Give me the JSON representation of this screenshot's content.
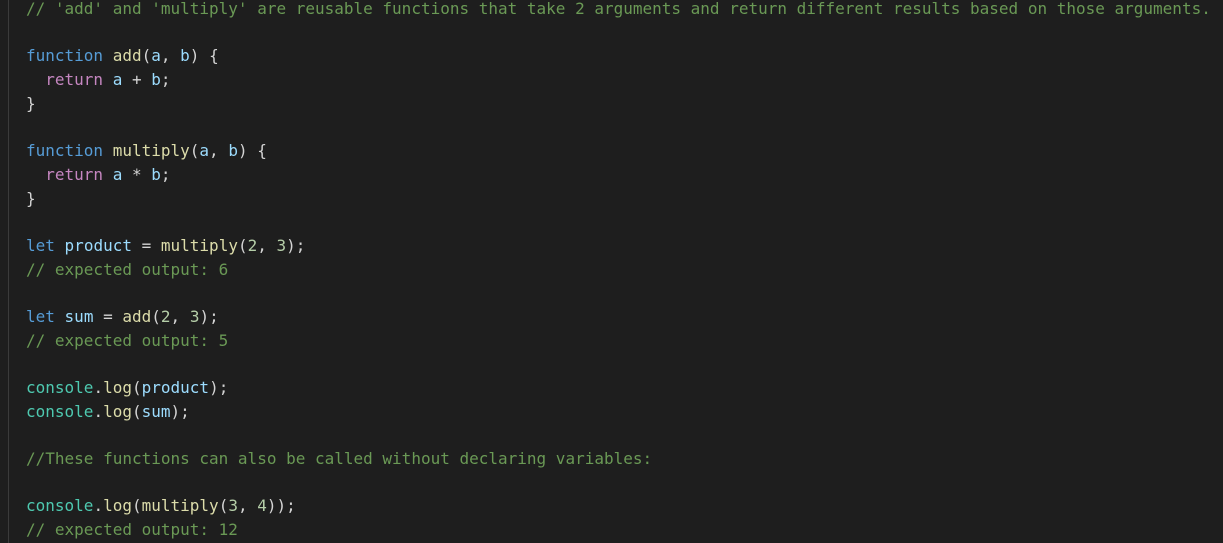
{
  "editor": {
    "theme": {
      "background": "#1e1e1e",
      "keyword": "#569cd6",
      "control": "#c586c0",
      "function": "#dcdcaa",
      "variable": "#9cdcfe",
      "object": "#4ec9b0",
      "number": "#b5cea8",
      "comment": "#6a9955",
      "text": "#d4d4d4"
    },
    "lines": [
      [
        {
          "t": "// 'add' and 'multiply' are reusable functions that take 2 arguments and return different results based on those arguments.",
          "c": "cm"
        }
      ],
      [],
      [
        {
          "t": "function",
          "c": "kw-blue"
        },
        {
          "t": " ",
          "c": "pl"
        },
        {
          "t": "add",
          "c": "fn"
        },
        {
          "t": "(",
          "c": "pl"
        },
        {
          "t": "a",
          "c": "var"
        },
        {
          "t": ", ",
          "c": "pl"
        },
        {
          "t": "b",
          "c": "var"
        },
        {
          "t": ") {",
          "c": "pl"
        }
      ],
      [
        {
          "t": "  ",
          "c": "pl"
        },
        {
          "t": "return",
          "c": "kw-ctrl"
        },
        {
          "t": " ",
          "c": "pl"
        },
        {
          "t": "a",
          "c": "var"
        },
        {
          "t": " + ",
          "c": "pl"
        },
        {
          "t": "b",
          "c": "var"
        },
        {
          "t": ";",
          "c": "pl"
        }
      ],
      [
        {
          "t": "}",
          "c": "pl"
        }
      ],
      [],
      [
        {
          "t": "function",
          "c": "kw-blue"
        },
        {
          "t": " ",
          "c": "pl"
        },
        {
          "t": "multiply",
          "c": "fn"
        },
        {
          "t": "(",
          "c": "pl"
        },
        {
          "t": "a",
          "c": "var"
        },
        {
          "t": ", ",
          "c": "pl"
        },
        {
          "t": "b",
          "c": "var"
        },
        {
          "t": ") {",
          "c": "pl"
        }
      ],
      [
        {
          "t": "  ",
          "c": "pl"
        },
        {
          "t": "return",
          "c": "kw-ctrl"
        },
        {
          "t": " ",
          "c": "pl"
        },
        {
          "t": "a",
          "c": "var"
        },
        {
          "t": " * ",
          "c": "pl"
        },
        {
          "t": "b",
          "c": "var"
        },
        {
          "t": ";",
          "c": "pl"
        }
      ],
      [
        {
          "t": "}",
          "c": "pl"
        }
      ],
      [],
      [
        {
          "t": "let",
          "c": "kw-blue"
        },
        {
          "t": " ",
          "c": "pl"
        },
        {
          "t": "product",
          "c": "var"
        },
        {
          "t": " = ",
          "c": "pl"
        },
        {
          "t": "multiply",
          "c": "fn"
        },
        {
          "t": "(",
          "c": "pl"
        },
        {
          "t": "2",
          "c": "num"
        },
        {
          "t": ", ",
          "c": "pl"
        },
        {
          "t": "3",
          "c": "num"
        },
        {
          "t": ");",
          "c": "pl"
        }
      ],
      [
        {
          "t": "// expected output: 6",
          "c": "cm"
        }
      ],
      [],
      [
        {
          "t": "let",
          "c": "kw-blue"
        },
        {
          "t": " ",
          "c": "pl"
        },
        {
          "t": "sum",
          "c": "var"
        },
        {
          "t": " = ",
          "c": "pl"
        },
        {
          "t": "add",
          "c": "fn"
        },
        {
          "t": "(",
          "c": "pl"
        },
        {
          "t": "2",
          "c": "num"
        },
        {
          "t": ", ",
          "c": "pl"
        },
        {
          "t": "3",
          "c": "num"
        },
        {
          "t": ");",
          "c": "pl"
        }
      ],
      [
        {
          "t": "// expected output: 5",
          "c": "cm"
        }
      ],
      [],
      [
        {
          "t": "console",
          "c": "obj"
        },
        {
          "t": ".",
          "c": "pl"
        },
        {
          "t": "log",
          "c": "fn"
        },
        {
          "t": "(",
          "c": "pl"
        },
        {
          "t": "product",
          "c": "var"
        },
        {
          "t": ");",
          "c": "pl"
        }
      ],
      [
        {
          "t": "console",
          "c": "obj"
        },
        {
          "t": ".",
          "c": "pl"
        },
        {
          "t": "log",
          "c": "fn"
        },
        {
          "t": "(",
          "c": "pl"
        },
        {
          "t": "sum",
          "c": "var"
        },
        {
          "t": ");",
          "c": "pl"
        }
      ],
      [],
      [
        {
          "t": "//These functions can also be called without declaring variables:",
          "c": "cm"
        }
      ],
      [],
      [
        {
          "t": "console",
          "c": "obj"
        },
        {
          "t": ".",
          "c": "pl"
        },
        {
          "t": "log",
          "c": "fn"
        },
        {
          "t": "(",
          "c": "pl"
        },
        {
          "t": "multiply",
          "c": "fn"
        },
        {
          "t": "(",
          "c": "pl"
        },
        {
          "t": "3",
          "c": "num"
        },
        {
          "t": ", ",
          "c": "pl"
        },
        {
          "t": "4",
          "c": "num"
        },
        {
          "t": "));",
          "c": "pl"
        }
      ],
      [
        {
          "t": "// expected output: 12",
          "c": "cm"
        }
      ]
    ]
  }
}
